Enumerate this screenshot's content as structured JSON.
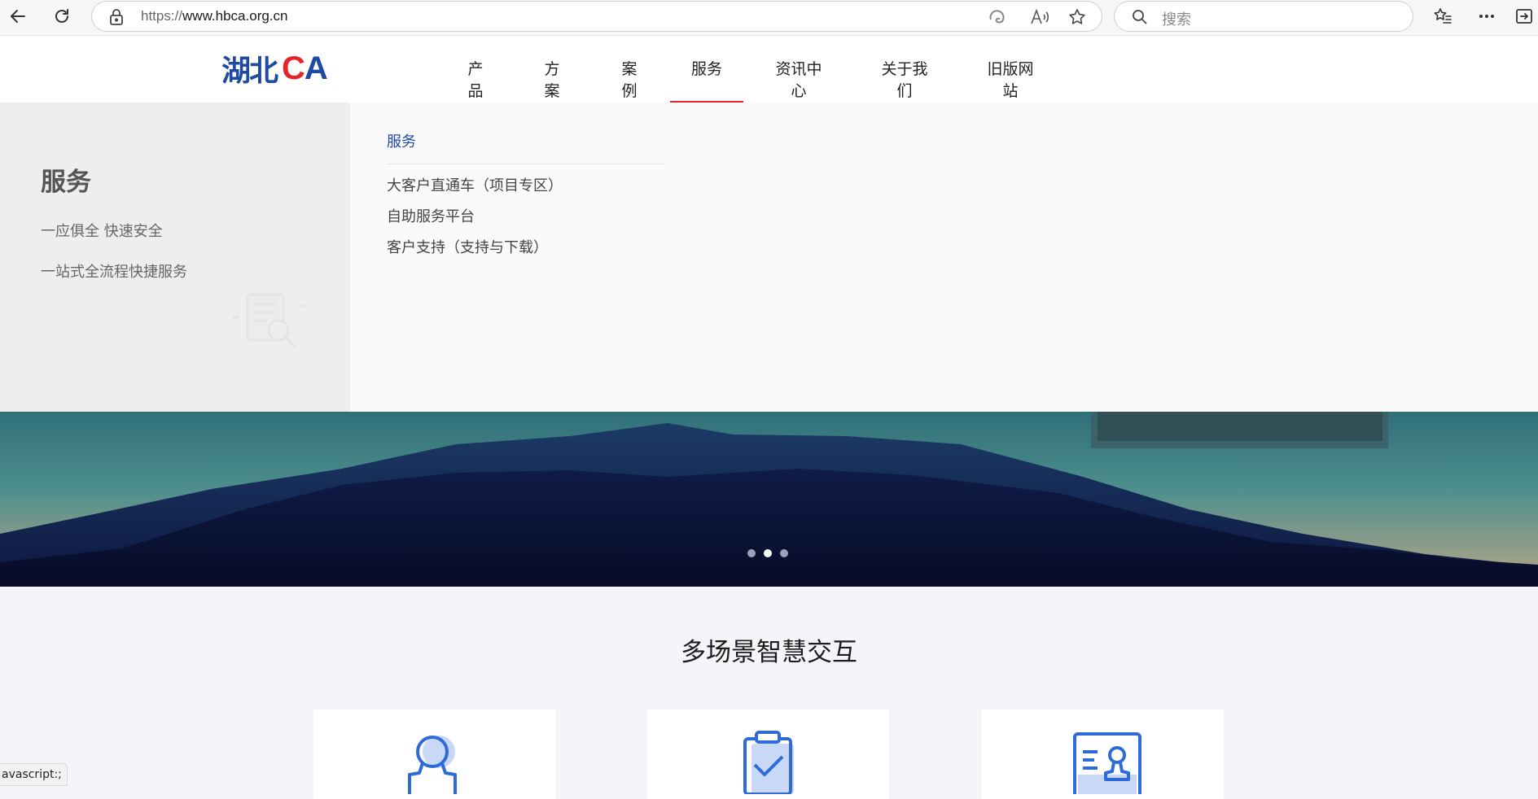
{
  "browser": {
    "url_protocol": "https://",
    "url_host": "www.hbca.org.cn",
    "search_placeholder": "搜索"
  },
  "site": {
    "logo_cn": "湖北",
    "logo_c": "C",
    "logo_a": "A",
    "nav": [
      {
        "label": "产品"
      },
      {
        "label": "方案"
      },
      {
        "label": "案例"
      },
      {
        "label": "服务"
      },
      {
        "label": "资讯中心"
      },
      {
        "label": "关于我们"
      },
      {
        "label": "旧版网站"
      }
    ],
    "active_nav": "服务"
  },
  "dropdown": {
    "title": "服务",
    "taglines": [
      "一应俱全 快速安全",
      "一站式全流程快捷服务"
    ],
    "heading": "服务",
    "links": [
      "大客户直通车（项目专区）",
      "自助服务平台",
      "客户支持（支持与下载）"
    ]
  },
  "banner": {
    "dots": 3,
    "active_dot": 2
  },
  "section": {
    "title": "多场景智慧交互"
  },
  "statusbar": {
    "text": "avascript:;"
  },
  "colors": {
    "brand_blue": "#1f4aa2",
    "brand_red": "#e3262b",
    "icon_blue": "#2f6bd8"
  }
}
